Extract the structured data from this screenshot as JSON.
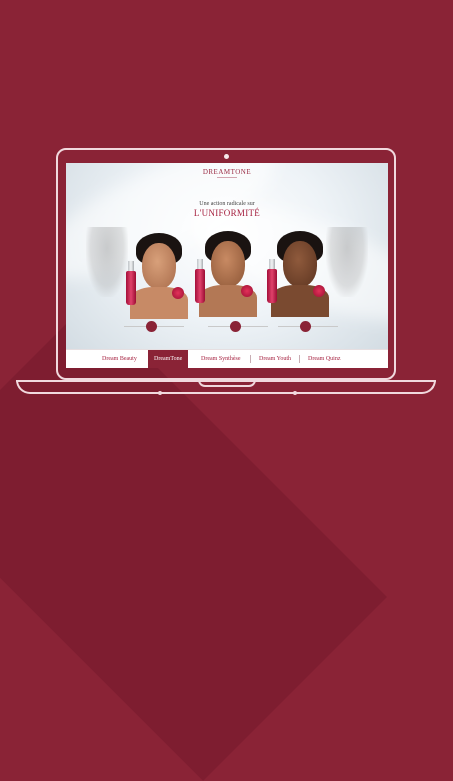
{
  "site": {
    "brand": "DREAMTONE",
    "tagline": "Une action radicale sur",
    "headline": "L'UNIFORMITÉ"
  },
  "nav": {
    "items": [
      {
        "label": "Dream Beauty",
        "active": false
      },
      {
        "label": "DreamTone",
        "active": true
      },
      {
        "label": "Dream Synthèse",
        "active": false
      },
      {
        "label": "Dream Youth",
        "active": false
      },
      {
        "label": "Dream Quinz",
        "active": false
      }
    ]
  },
  "colors": {
    "background": "#8a2336",
    "accent": "#a5203f",
    "laptop_outline": "#f1d9de"
  }
}
